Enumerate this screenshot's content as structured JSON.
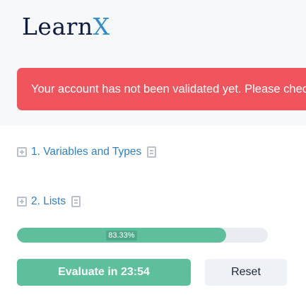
{
  "brand": {
    "logo_prefix": "Learn",
    "logo_suffix": "X",
    "colors": {
      "navy": "#0d1b3e",
      "accent": "#2f8cc9"
    }
  },
  "alert": {
    "message": "Your account has not been validated yet. Please check your email",
    "color": "#f0555e"
  },
  "modules": [
    {
      "label": "1. Variables and Types",
      "expand_icon": "plus-square-icon",
      "doc_icon": "document-icon"
    },
    {
      "label": "2. Lists",
      "expand_icon": "plus-square-icon",
      "doc_icon": "document-icon"
    }
  ],
  "progress": {
    "value": 0.8333,
    "label": "83.33%",
    "color": "#5dbf9c"
  },
  "actions": {
    "evaluate_label": "Evaluate in 23:54",
    "reset_label": "Reset"
  }
}
